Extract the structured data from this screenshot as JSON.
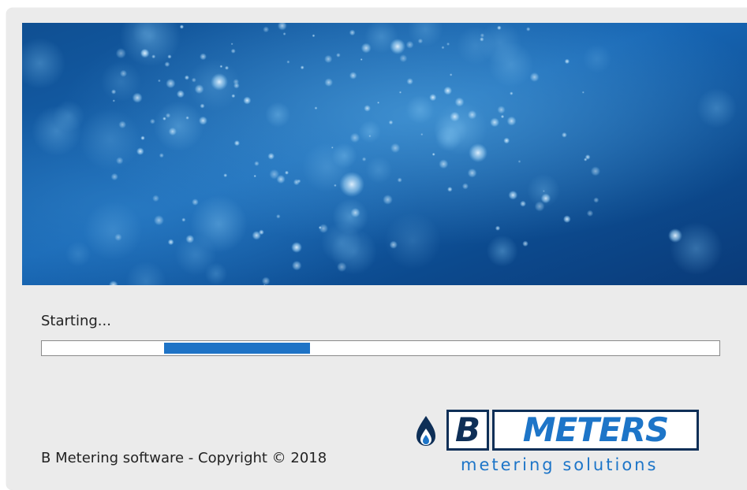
{
  "splash": {
    "status_text": "Starting...",
    "progress": {
      "indeterminate": true,
      "chunk_start_fraction": 0.18,
      "chunk_width_fraction": 0.215,
      "color": "#1e73c6"
    },
    "copyright": "B Metering software - Copyright © 2018",
    "banner": {
      "image": "blue-bokeh-water-bubbles",
      "colors": [
        "#0a3c78",
        "#1b64b0",
        "#4e9ed6"
      ]
    },
    "logo": {
      "icon": "water-drop-icon",
      "brand_letter": "B",
      "brand_word": "METERS",
      "tagline": "metering solutions",
      "colors": {
        "dark": "#0e2f57",
        "accent": "#1d75c8"
      }
    }
  }
}
